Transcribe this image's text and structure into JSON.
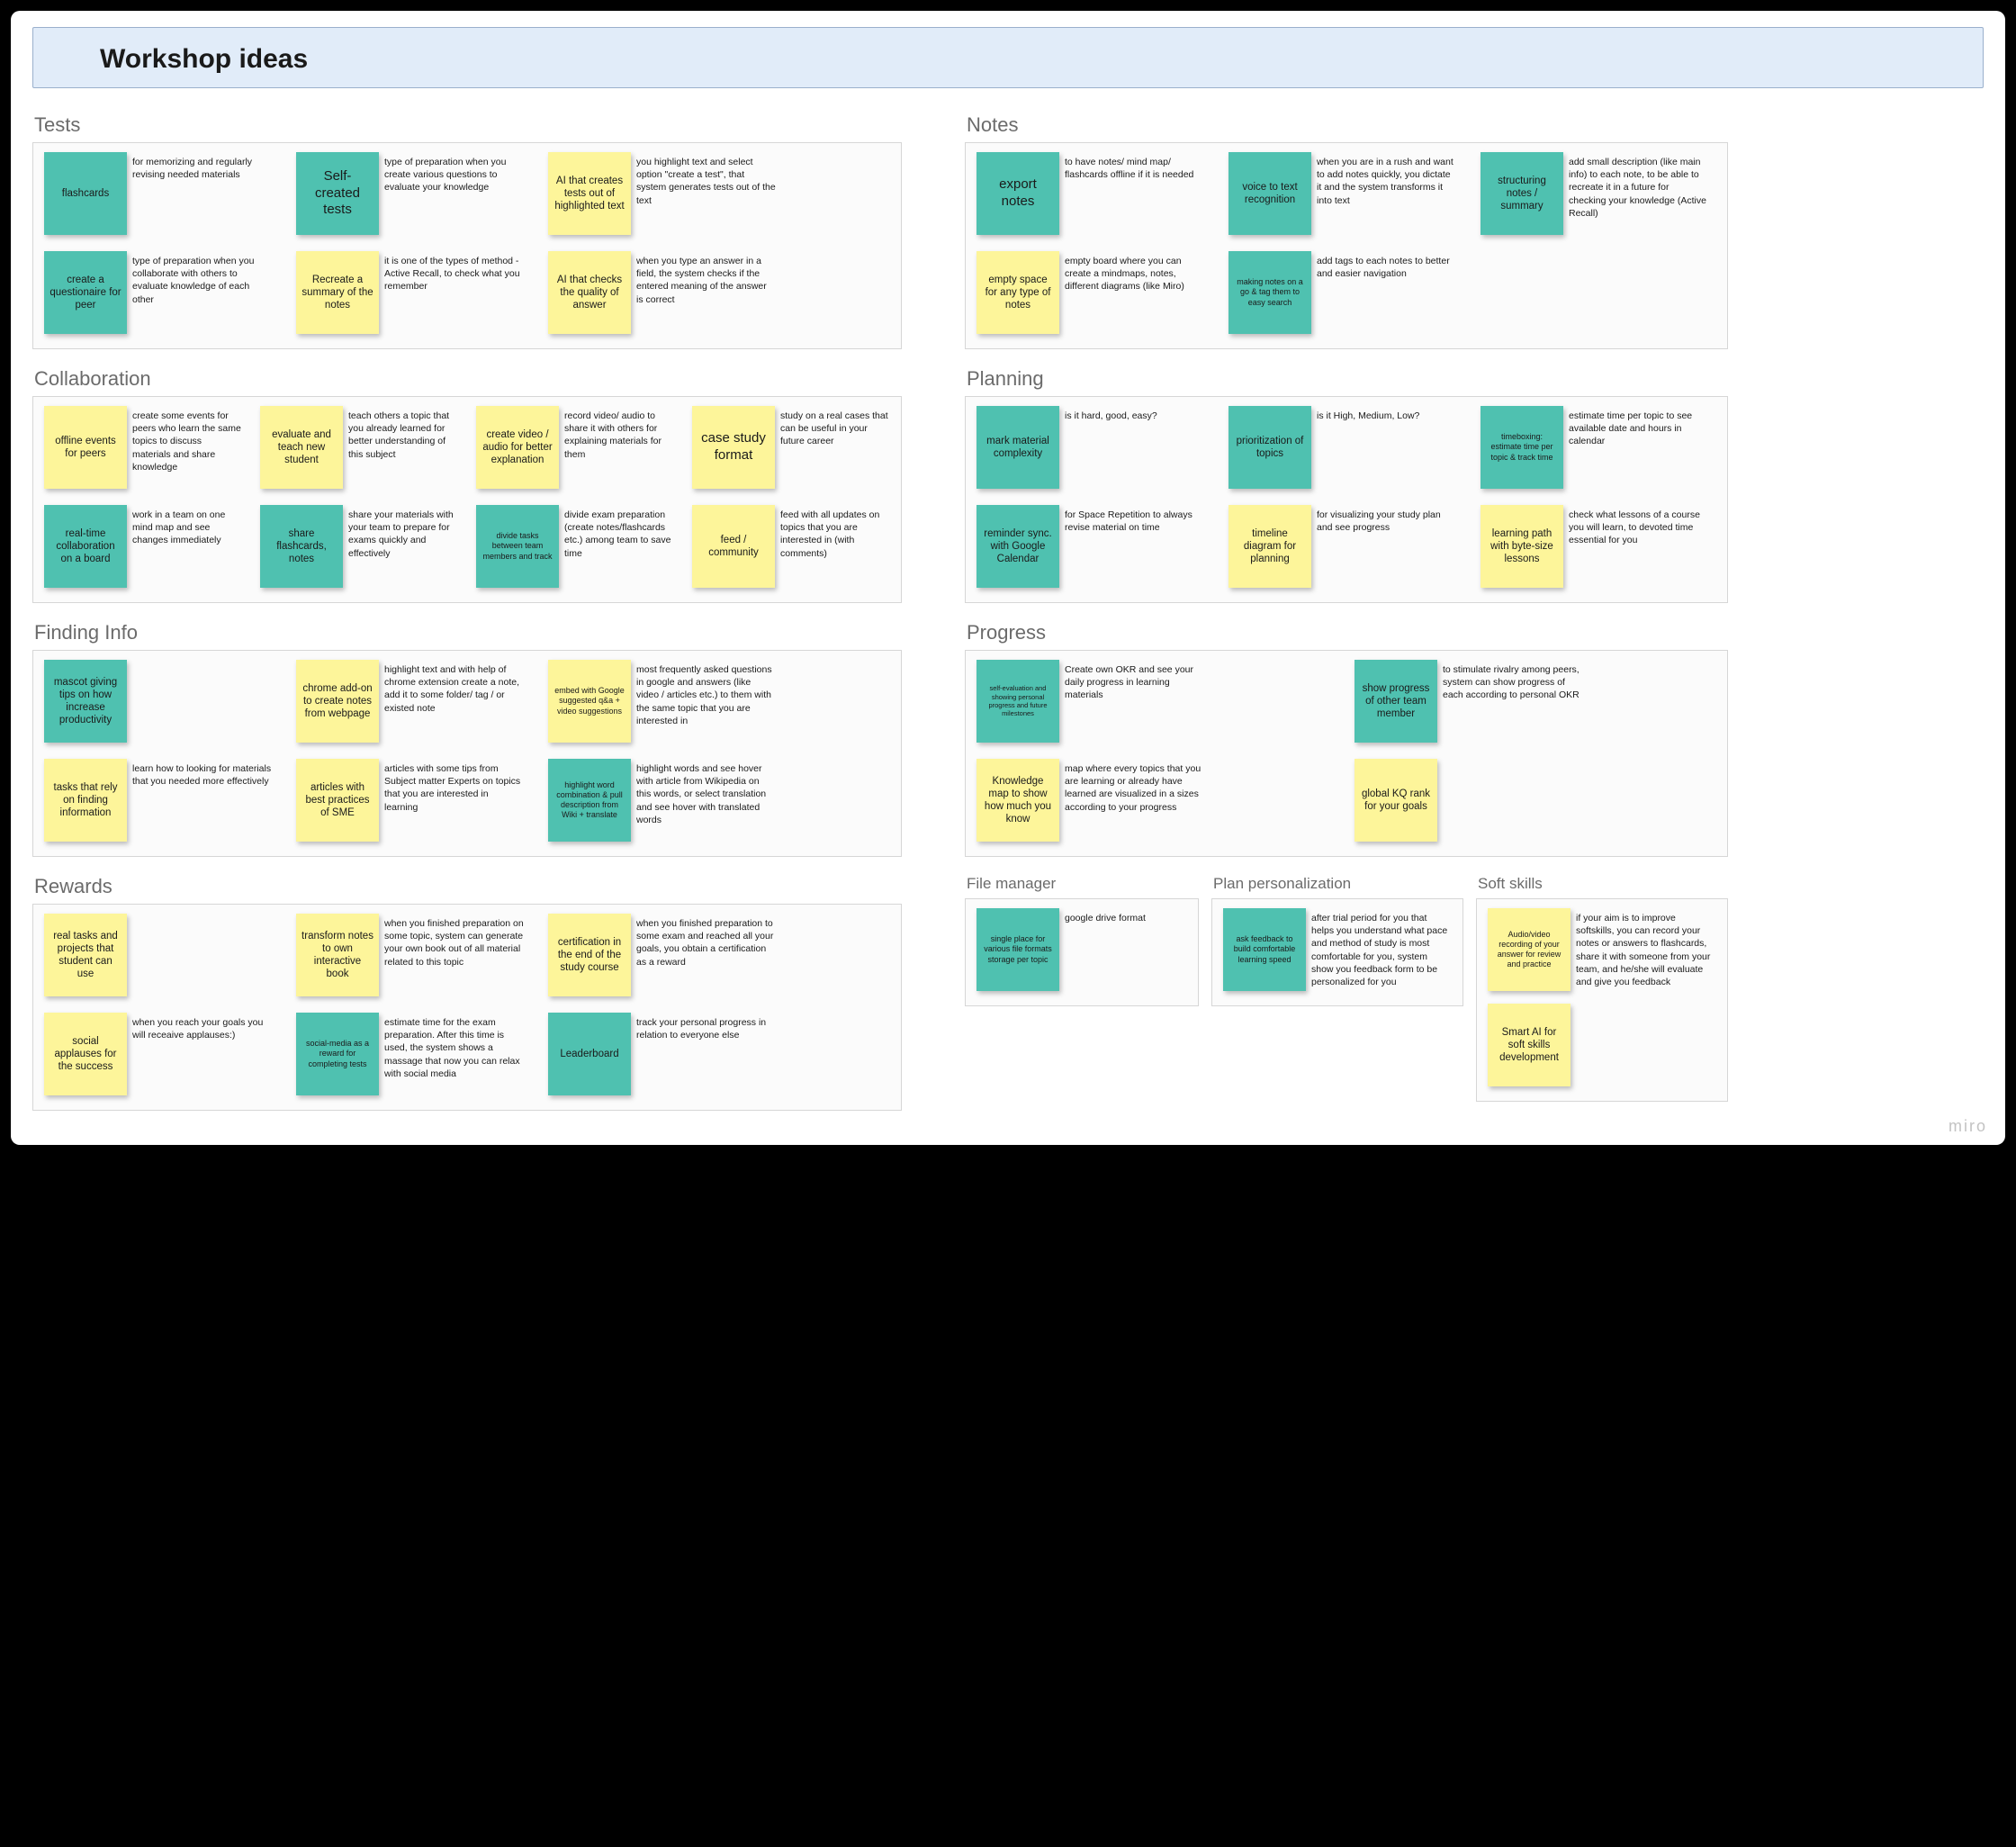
{
  "title": "Workshop ideas",
  "watermark": "miro",
  "sections": {
    "tests": {
      "title": "Tests",
      "cards": [
        {
          "label": "flashcards",
          "desc": "for memorizing and regularly revising needed materials",
          "color": "teal"
        },
        {
          "label": "Self-created tests",
          "desc": "type of preparation when you create various questions to evaluate your knowledge",
          "color": "teal"
        },
        {
          "label": "AI that creates tests out of highlighted text",
          "desc": "you highlight text and select option \"create a test\", that system generates tests out of the text",
          "color": "yellow"
        },
        {
          "label": "create a questionaire for peer",
          "desc": "type of preparation when you collaborate with others to evaluate knowledge of each other",
          "color": "teal"
        },
        {
          "label": "Recreate a summary of the notes",
          "desc": "it is one of the types of method - Active Recall, to check what you remember",
          "color": "yellow"
        },
        {
          "label": "AI that checks the quality of answer",
          "desc": "when you type an answer in a field, the system checks if the entered meaning of the answer is correct",
          "color": "yellow"
        }
      ]
    },
    "notes": {
      "title": "Notes",
      "cards": [
        {
          "label": "export notes",
          "desc": "to have notes/ mind map/ flashcards offline if it is needed",
          "color": "teal"
        },
        {
          "label": "voice to text recognition",
          "desc": "when you are in a rush and want to add notes quickly, you dictate it and the system transforms it into text",
          "color": "teal"
        },
        {
          "label": "structuring notes / summary",
          "desc": "add small description (like main info) to each note, to be able to recreate it in a future for checking your knowledge (Active Recall)",
          "color": "teal"
        },
        {
          "label": "empty space for any type of notes",
          "desc": "empty board where you can create a mindmaps, notes, different diagrams (like Miro)",
          "color": "yellow"
        },
        {
          "label": "making notes on a go & tag them to easy search",
          "desc": "add tags to each notes to better and easier navigation",
          "color": "teal"
        }
      ]
    },
    "collaboration": {
      "title": "Collaboration",
      "cards": [
        {
          "label": "offline events for peers",
          "desc": "create some events for peers who learn the same topics to discuss materials and share knowledge",
          "color": "yellow"
        },
        {
          "label": "evaluate and teach new student",
          "desc": "teach others a topic that you already learned for better understanding of this subject",
          "color": "yellow"
        },
        {
          "label": "create video / audio for better explanation",
          "desc": "record video/ audio to share it with others for explaining materials for them",
          "color": "yellow"
        },
        {
          "label": "case study format",
          "desc": "study on a real cases that can be useful in your future career",
          "color": "yellow"
        },
        {
          "label": "real-time collaboration on a board",
          "desc": "work in a team on one mind map and see changes immediately",
          "color": "teal"
        },
        {
          "label": "share flashcards, notes",
          "desc": "share your materials with your team to prepare for exams quickly and effectively",
          "color": "teal"
        },
        {
          "label": "divide tasks between team members and track",
          "desc": "divide exam preparation (create notes/flashcards etc.) among team to save time",
          "color": "teal"
        },
        {
          "label": "feed / community",
          "desc": "feed with all updates on topics that you are interested in (with comments)",
          "color": "yellow"
        }
      ]
    },
    "planning": {
      "title": "Planning",
      "cards": [
        {
          "label": "mark material complexity",
          "desc": "is it hard, good, easy?",
          "color": "teal"
        },
        {
          "label": "prioritization of topics",
          "desc": "is it High, Medium, Low?",
          "color": "teal"
        },
        {
          "label": "timeboxing: estimate time per topic & track time",
          "desc": "estimate time per topic to see available date and hours in calendar",
          "color": "teal"
        },
        {
          "label": "reminder sync. with Google Calendar",
          "desc": "for Space Repetition to always revise material on time",
          "color": "teal"
        },
        {
          "label": "timeline diagram for planning",
          "desc": "for visualizing your study plan and see progress",
          "color": "yellow"
        },
        {
          "label": "learning path with byte-size lessons",
          "desc": "check what lessons of a course you will learn, to devoted time essential for you",
          "color": "yellow"
        }
      ]
    },
    "finding": {
      "title": "Finding Info",
      "cards": [
        {
          "label": "mascot giving tips on how increase productivity",
          "desc": "",
          "color": "teal"
        },
        {
          "label": "chrome add-on to create notes from webpage",
          "desc": "highlight text and with help of chrome extension create a note, add it to some folder/ tag / or existed note",
          "color": "yellow"
        },
        {
          "label": "embed with Google suggested q&a + video suggestions",
          "desc": "most frequently asked questions in google and answers (like video / articles etc.) to them with the same topic that you are interested in",
          "color": "yellow"
        },
        {
          "label": "tasks that rely on finding information",
          "desc": "learn how to looking for materials that you needed more effectively",
          "color": "yellow"
        },
        {
          "label": "articles with best practices of SME",
          "desc": "articles with some tips from Subject matter Experts on topics that you are interested in learning",
          "color": "yellow"
        },
        {
          "label": "highlight word combination & pull description from Wiki + translate",
          "desc": "highlight words and see hover with article from Wikipedia on this words, or select translation and see hover with translated words",
          "color": "teal"
        }
      ]
    },
    "progress": {
      "title": "Progress",
      "cards": [
        {
          "label": "self-evaluation and showing personal progress and future milestones",
          "desc": "Create own OKR and see your daily progress in learning materials",
          "color": "teal"
        },
        {
          "label": "show progress of other team member",
          "desc": "to stimulate rivalry among peers, system can show progress of each according to personal OKR",
          "color": "teal"
        },
        {
          "label": "Knowledge map to show how much you know",
          "desc": "map where every topics that you are learning or already have learned are visualized in a sizes according to your progress",
          "color": "yellow"
        },
        {
          "label": "global KQ rank for your goals",
          "desc": "",
          "color": "yellow"
        }
      ]
    },
    "rewards": {
      "title": "Rewards",
      "cards": [
        {
          "label": "real tasks and projects that student can use",
          "desc": "",
          "color": "yellow"
        },
        {
          "label": "transform notes to own interactive book",
          "desc": "when you finished preparation on some topic, system can generate your own book out of all material related to this topic",
          "color": "yellow"
        },
        {
          "label": "certification in the end of the study course",
          "desc": "when you finished preparation to some exam and reached all your goals, you obtain a certification as a reward",
          "color": "yellow"
        },
        {
          "label": "social applauses for the success",
          "desc": "when you reach your goals you will receaive applauses:)",
          "color": "yellow"
        },
        {
          "label": "social-media as a reward for completing tests",
          "desc": "estimate time for the exam preparation. After this time is used, the system shows a massage that now you can relax with social media",
          "color": "teal"
        },
        {
          "label": "Leaderboard",
          "desc": "track your personal progress in relation to everyone else",
          "color": "teal"
        }
      ]
    },
    "filemanager": {
      "title": "File manager",
      "cards": [
        {
          "label": "single place for various file formats storage per topic",
          "desc": "google drive format",
          "color": "teal"
        }
      ]
    },
    "personalization": {
      "title": "Plan personalization",
      "cards": [
        {
          "label": "ask feedback to build comfortable learning speed",
          "desc": "after trial period for you that helps you understand what pace and method of study is most comfortable for you, system show you feedback form to be personalized for you",
          "color": "teal"
        }
      ]
    },
    "softskills": {
      "title": "Soft skills",
      "cards": [
        {
          "label": "Audio/video recording of your answer for review and practice",
          "desc": "if your aim is to improve softskills, you can record your notes or answers to flashcards, share it with someone from your team, and he/she will evaluate and give you feedback",
          "color": "yellow"
        },
        {
          "label": "Smart AI for soft skills development",
          "desc": "",
          "color": "yellow"
        }
      ]
    }
  }
}
